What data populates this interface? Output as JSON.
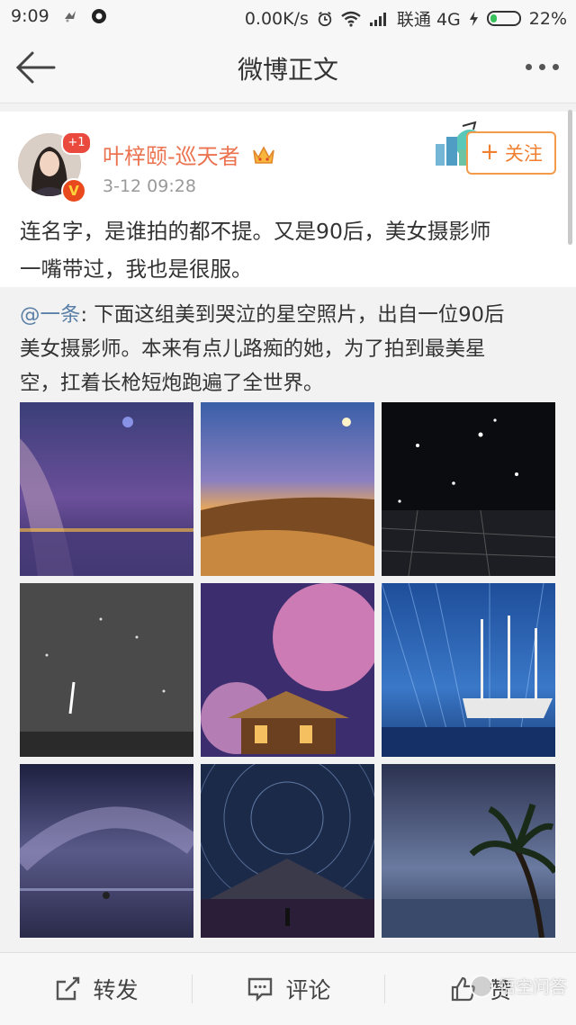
{
  "status_bar": {
    "time": "9:09",
    "net_speed": "0.00K/s",
    "carrier": "联通 4G",
    "battery_percent": "22%",
    "battery_level": 0.22,
    "battery_color": "#38c15a"
  },
  "nav": {
    "title": "微博正文",
    "back_icon": "arrow-left-icon",
    "more_icon": "more-dots-icon"
  },
  "post": {
    "username": "叶梓颐-巡天者",
    "time": "3-12 09:28",
    "badge_plus": "+1",
    "badge_v": "V",
    "follow_label": "关注",
    "text_line1": "连名字，是谁拍的都不提。又是90后，美女摄影师",
    "text_line2": "一嘴带过，我也是很服。"
  },
  "repost": {
    "mention": "@一条",
    "line1": ": 下面这组美到哭泣的星空照片，出自一位90后",
    "line2": "美女摄影师。本来有点儿路痴的她，为了拍到最美星",
    "line3": "空，扛着长枪短炮跑遍了全世界。",
    "photos": [
      "milky-way-salt-flat",
      "milky-way-desert-dunes",
      "starry-sky-salt-flat",
      "meteor-over-ocean",
      "cherry-blossom-pavilion",
      "star-trails-pirate-ship",
      "milky-way-reflection",
      "star-trails-pyramid",
      "palm-tree-night-beach"
    ]
  },
  "actions": {
    "repost_label": "转发",
    "comment_label": "评论",
    "like_label": "赞"
  },
  "watermark": {
    "text": "悟空问答"
  },
  "colors": {
    "username": "#eb7350",
    "follow": "#f08030",
    "mention": "#5a80a8"
  }
}
